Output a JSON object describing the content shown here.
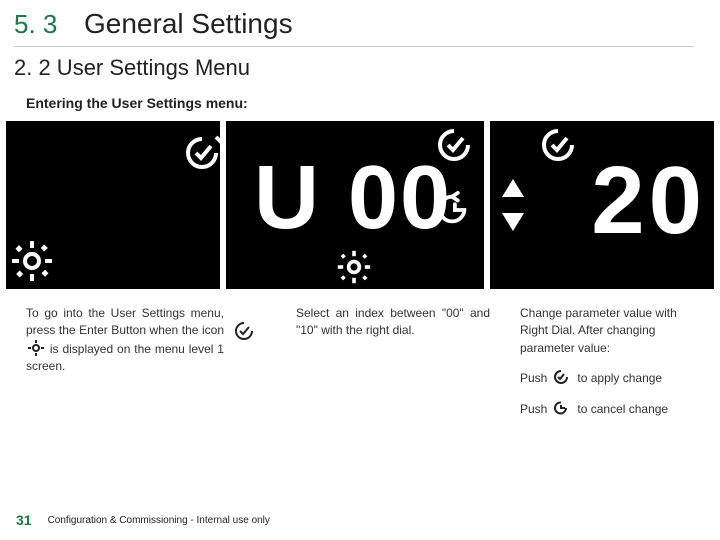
{
  "header": {
    "section_number": "5. 3",
    "section_title": "General Settings"
  },
  "subtitle": "2. 2 User Settings Menu",
  "lead": "Entering the User Settings menu:",
  "panels": {
    "panel2_display": "U 00",
    "panel3_display": "20"
  },
  "captions": {
    "c1_a": "To go into the User Settings menu, press the Enter Button when the icon ",
    "c1_b": " is displayed on the menu level 1 screen.",
    "c2": "Select an index between \"00\" and \"10\" with the right dial.",
    "c3_main": "Change parameter value with Right Dial. After changing parameter value:",
    "c3_push": "Push",
    "c3_apply": "to apply change",
    "c3_cancel": "to cancel change"
  },
  "footer": {
    "page": "31",
    "note": "Configuration & Commissioning - Internal use only"
  }
}
